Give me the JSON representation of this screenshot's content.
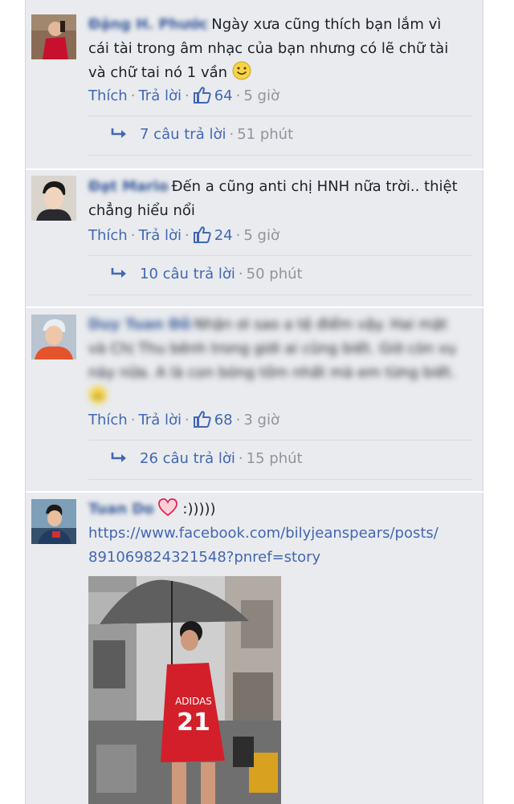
{
  "comments": [
    {
      "name": "Đặng H. Phước",
      "text": "Ngày xưa cũng thích bạn lắm vì cái tài trong âm nhạc của bạn nhưng có lẽ chữ tài và chữ tai nó 1 vần",
      "like_label": "Thích",
      "reply_label": "Trả lời",
      "likes": "64",
      "time": "5 giờ",
      "reply_count_label": "7 câu trả lời",
      "reply_time": "51 phút"
    },
    {
      "name": "Đạt Mario",
      "text": "Đến a cũng anti chị HNH nữa trời.. thiệt chẳng hiểu nổi",
      "like_label": "Thích",
      "reply_label": "Trả lời",
      "likes": "24",
      "time": "5 giờ",
      "reply_count_label": "10 câu trả lời",
      "reply_time": "50 phút"
    },
    {
      "name": "Duy Tuan Đỗ",
      "text": "Nhận ơi sao a tệ điểm vậy. Hai mặt và Chị Thu bênh trong giới ai cũng biết. Giờ còn vụ này nữa. A là con bóng tồm nhất mà em từng biết.",
      "like_label": "Thích",
      "reply_label": "Trả lời",
      "likes": "68",
      "time": "3 giờ",
      "reply_count_label": "26 câu trả lời",
      "reply_time": "15 phút"
    },
    {
      "name": "Tuan Do",
      "text": ":)))))",
      "url_line1": "https://www.facebook.com/bilyjeanspears/posts/",
      "url_line2": "891069824321548?pnref=story",
      "photo_caption": "ADIDAS 21"
    }
  ],
  "colors": {
    "link": "#4267b2",
    "muted": "#90949c",
    "text": "#1d2129",
    "panel": "#e9ebee"
  },
  "icons": [
    "thumbs-up-icon",
    "reply-arrow-icon",
    "smiley-icon",
    "heart-icon"
  ]
}
